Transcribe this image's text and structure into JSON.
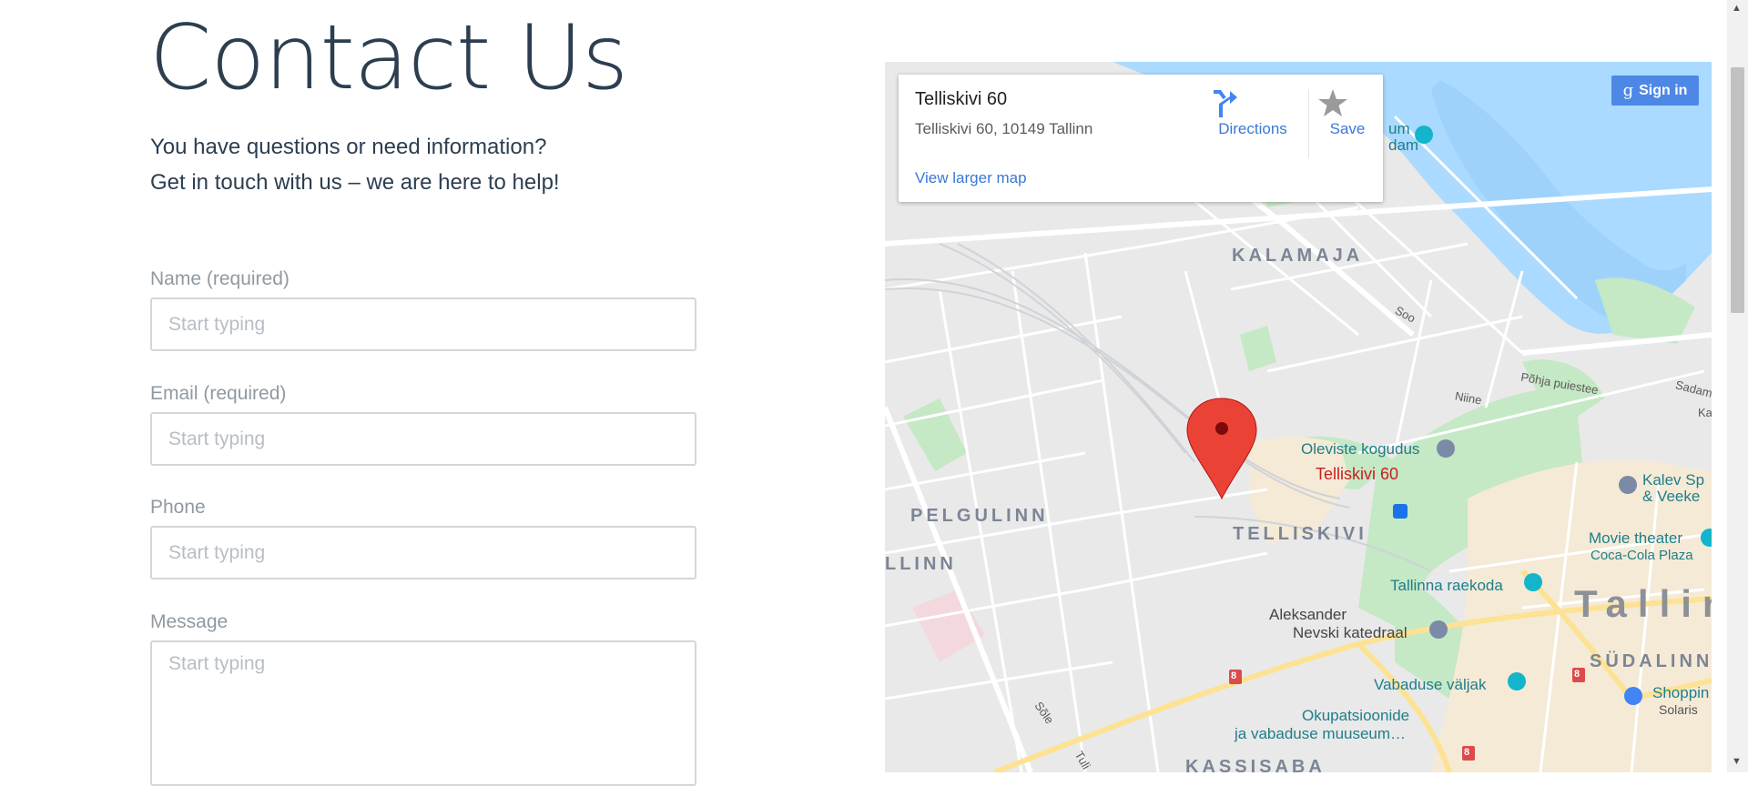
{
  "page": {
    "title": "Contact Us",
    "intro_line1": "You have questions or need information?",
    "intro_line2": "Get in touch with us – we are here to help!"
  },
  "form": {
    "name_label": "Name (required)",
    "name_placeholder": "Start typing",
    "email_label": "Email (required)",
    "email_placeholder": "Start typing",
    "phone_label": "Phone",
    "phone_placeholder": "Start typing",
    "message_label": "Message",
    "message_placeholder": "Start typing"
  },
  "map": {
    "card": {
      "title": "Telliskivi 60",
      "address": "Telliskivi 60, 10149 Tallinn",
      "directions_label": "Directions",
      "save_label": "Save",
      "view_larger_label": "View larger map"
    },
    "sign_in_label": "Sign in",
    "sign_in_glyph": "g",
    "marker_label": "Telliskivi 60",
    "districts": {
      "kalamaja": "KALAMAJA",
      "pelgulinn": "PELGULINN",
      "telliskivi": "TELLISKIVI",
      "llinn": "LLINN",
      "sudalinn": "SÜDALINN",
      "kassisaba": "KASSISABA",
      "tallinn": "Tallin"
    },
    "pois": {
      "museum_partial": "um",
      "museum_partial2": "dam",
      "oleviste": "Oleviste kogudus",
      "kalev_1": "Kalev Sp",
      "kalev_2": "& Veeke",
      "movie_1": "Movie theater",
      "movie_2": "Coca-Cola Plaza",
      "raekoda": "Tallinna raekoda",
      "nevski_1": "Aleksander",
      "nevski_2": "Nevski katedraal",
      "vabaduse": "Vabaduse väljak",
      "okup_1": "Okupatsioonide",
      "okup_2": "ja vabaduse muuseum…",
      "shopping_1": "Shoppin",
      "shopping_2": "Solaris"
    },
    "streets": {
      "soo": "Soo",
      "pohja": "Põhja puiestee",
      "niine": "Niine",
      "sadam": "Sadam",
      "ka": "Ka",
      "sole": "Sõle",
      "tuli": "Tuli"
    },
    "route_badge": "8",
    "colors": {
      "water": "#aadaff",
      "park": "#c5e8c5",
      "road_major": "#fde293",
      "land": "#e9e9e9",
      "marker": "#ea4335",
      "link": "#3a78d8"
    }
  }
}
